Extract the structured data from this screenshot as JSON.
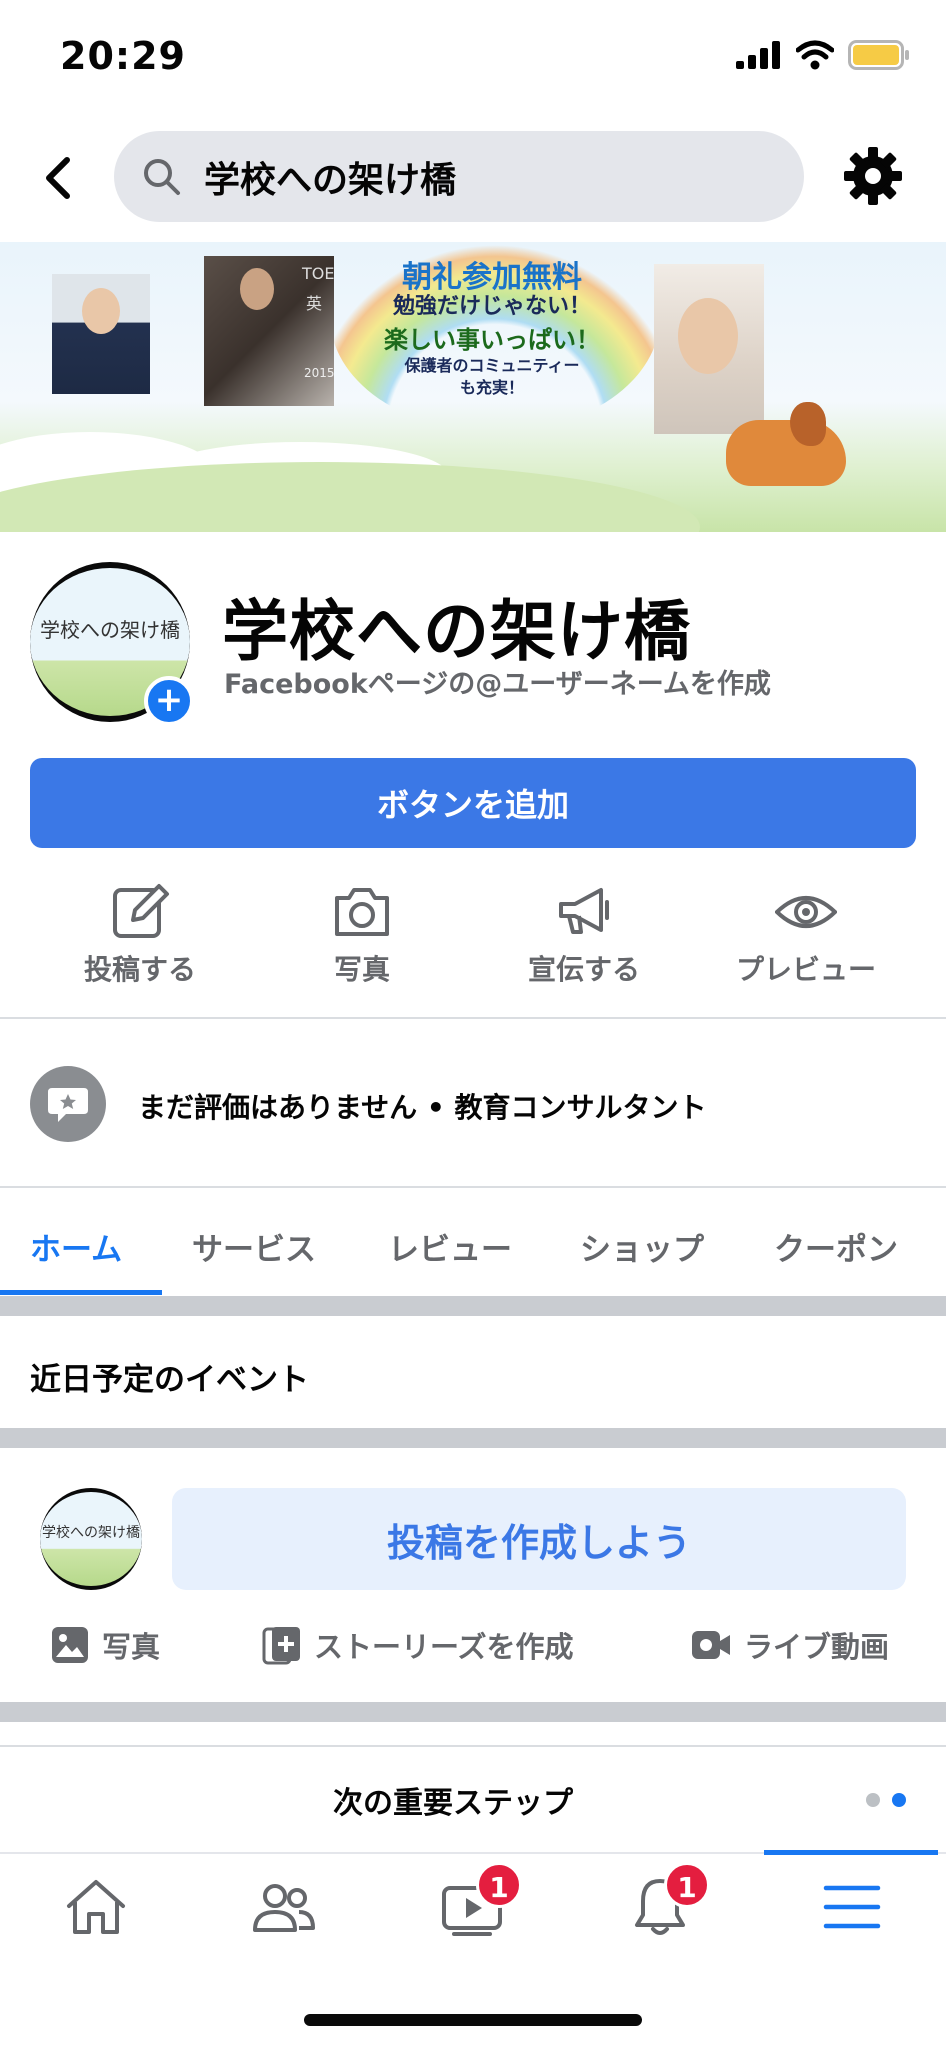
{
  "status_bar": {
    "time": "20:29"
  },
  "header": {
    "search_text": "学校への架け橋"
  },
  "cover": {
    "line1": "朝礼参加無料",
    "line2": "勉強だけじゃない！",
    "line3": "楽しい事いっぱい！",
    "line4": "保護者のコミュニティー",
    "line5": "も充実！",
    "photo_text": "TOEF",
    "photo_text2": "英",
    "photo_text3": "2015"
  },
  "profile": {
    "avatar_text": "学校への架け橋",
    "name": "学校への架け橋",
    "username_prompt": "Facebookページの@ユーザーネームを作成"
  },
  "add_button_label": "ボタンを追加",
  "actions": [
    {
      "label": "投稿する",
      "icon": "edit-icon"
    },
    {
      "label": "写真",
      "icon": "camera-icon"
    },
    {
      "label": "宣伝する",
      "icon": "megaphone-icon"
    },
    {
      "label": "プレビュー",
      "icon": "eye-icon"
    }
  ],
  "rating_line": "まだ評価はありません • 教育コンサルタント",
  "tabs": [
    "ホーム",
    "サービス",
    "レビュー",
    "ショップ",
    "クーポン"
  ],
  "upcoming_events_title": "近日予定のイベント",
  "composer": {
    "avatar_text": "学校への架け橋",
    "placeholder": "投稿を作成しよう",
    "photo_label": "写真",
    "story_label": "ストーリーズを作成",
    "live_label": "ライブ動画"
  },
  "next_steps_title": "次の重要ステップ",
  "bottom_nav": {
    "watch_badge": "1",
    "notifications_badge": "1"
  },
  "colors": {
    "accent": "#1877f2",
    "button": "#3b78e6",
    "badge": "#e41e3f"
  }
}
